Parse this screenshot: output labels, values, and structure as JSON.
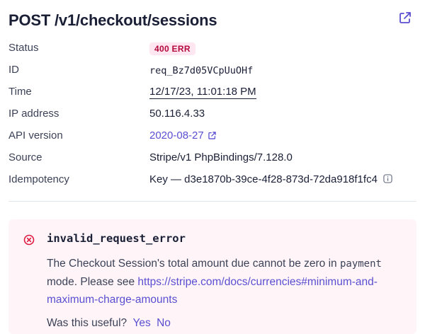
{
  "header": {
    "title": "POST /v1/checkout/sessions",
    "open_icon": "external-link-icon"
  },
  "details": {
    "status": {
      "label": "Status",
      "value": "400 ERR"
    },
    "id": {
      "label": "ID",
      "value": "req_Bz7d05VCpUuOHf"
    },
    "time": {
      "label": "Time",
      "value": "12/17/23, 11:01:18 PM"
    },
    "ip": {
      "label": "IP address",
      "value": "50.116.4.33"
    },
    "api_version": {
      "label": "API version",
      "value": "2020-08-27",
      "icon": "external-link-icon"
    },
    "source": {
      "label": "Source",
      "value": "Stripe/v1 PhpBindings/7.128.0"
    },
    "idempotency": {
      "label": "Idempotency",
      "value": "Key — d3e1870b-39ce-4f28-873d-72da918f1fc4",
      "icon": "info-icon"
    }
  },
  "error": {
    "icon": "error-circle-icon",
    "code": "invalid_request_error",
    "message_part1": "The Checkout Session's total amount due cannot be zero in ",
    "message_code": "payment",
    "message_part2": " mode. Please see ",
    "link": "https://stripe.com/docs/currencies#minimum-and-maximum-charge-amounts",
    "feedback_prompt": "Was this useful?",
    "yes_label": "Yes",
    "no_label": "No"
  },
  "colors": {
    "accent": "#5a4ed1",
    "error_badge_bg": "#ffe7f2",
    "error_badge_text": "#b3093c",
    "error_panel_bg": "#fff5f8"
  }
}
